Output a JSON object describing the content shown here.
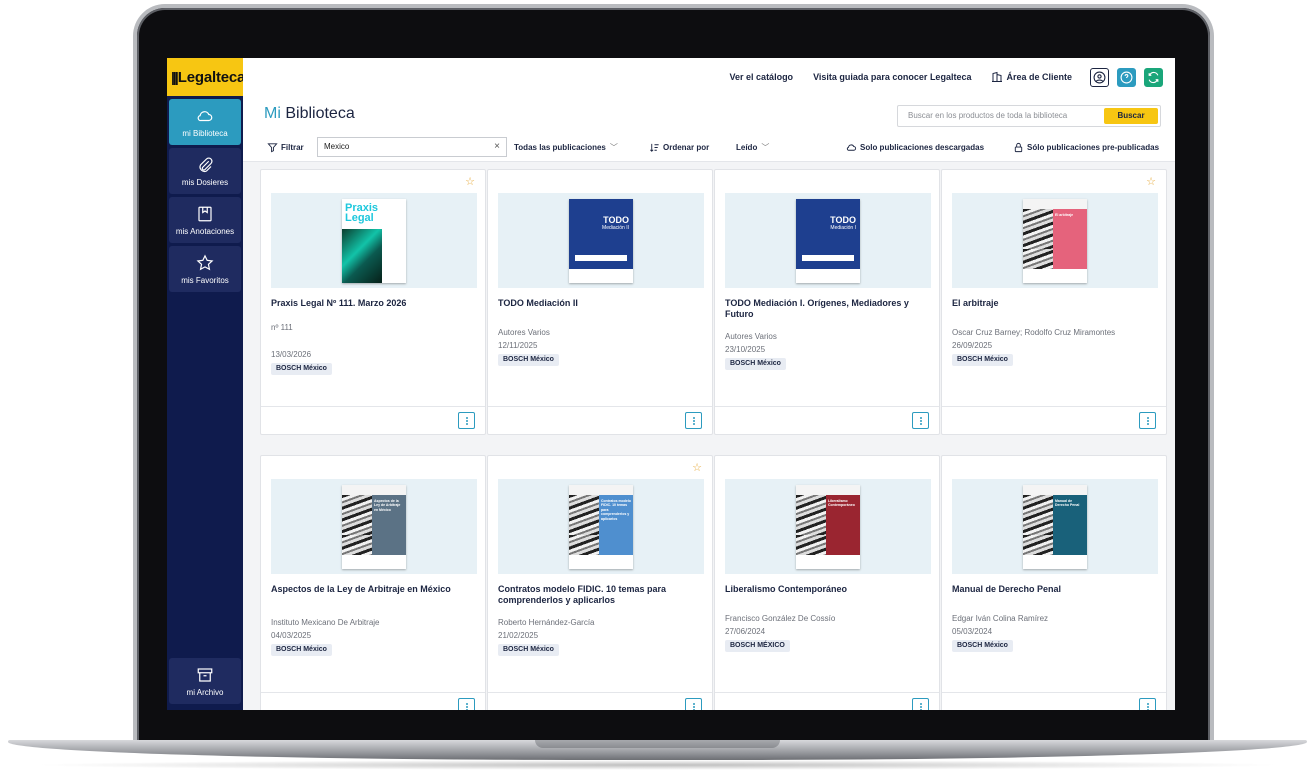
{
  "app": {
    "logo_text": "Legalteca",
    "page_title_prefix": "Mi",
    "page_title": "Biblioteca"
  },
  "sidebar": {
    "items": [
      {
        "label": "mi Biblioteca",
        "icon": "cloud-icon",
        "active": true
      },
      {
        "label": "mis Dosieres",
        "icon": "paperclip-icon"
      },
      {
        "label": "mis Anotaciones",
        "icon": "bookmark-icon"
      },
      {
        "label": "mis Favoritos",
        "icon": "star-icon"
      }
    ],
    "archive_label": "mi Archivo"
  },
  "header": {
    "catalog_link": "Ver el catálogo",
    "tour_link": "Visita guiada para conocer Legalteca",
    "client_area": "Área de Cliente",
    "icons": [
      "user-icon",
      "help-icon",
      "sync-icon"
    ]
  },
  "search": {
    "placeholder": "Buscar en los productos de toda la biblioteca",
    "button": "Buscar"
  },
  "filters": {
    "filter_label": "Filtrar",
    "filter_value": "Mexico",
    "publications": "Todas las publicaciones",
    "order_by": "Ordenar por",
    "read": "Leído",
    "downloaded": "Solo publicaciones descargadas",
    "prepublished": "Sólo publicaciones pre-publicadas"
  },
  "colors": {
    "sidebar": "#0f1b4d",
    "accent": "#2c9bbf",
    "brand_yellow": "#f7c612",
    "star": "#e6a93a"
  },
  "cards": [
    {
      "title": "Praxis Legal Nº 111. Marzo 2026",
      "author": "nº 111",
      "date": "13/03/2026",
      "publisher": "BOSCH México",
      "favorite": true,
      "cover": "praxis"
    },
    {
      "title": "TODO Mediación II",
      "author": "Autores Varios",
      "date": "12/11/2025",
      "publisher": "BOSCH México",
      "favorite": false,
      "cover": "todo2",
      "cover_title": "TODO",
      "cover_sub": "Mediación II"
    },
    {
      "title": "TODO Mediación I. Orígenes, Mediadores y Futuro",
      "author": "Autores Varios",
      "date": "23/10/2025",
      "publisher": "BOSCH México",
      "favorite": false,
      "cover": "todo1",
      "cover_title": "TODO",
      "cover_sub": "Mediación I"
    },
    {
      "title": "El arbitraje",
      "author": "Oscar Cruz Barney; Rodolfo Cruz Miramontes",
      "date": "26/09/2025",
      "publisher": "BOSCH México",
      "favorite": true,
      "cover": "pink",
      "cover_sub": "El arbitraje"
    },
    {
      "title": "Aspectos de la Ley de Arbitraje en México",
      "author": "Instituto Mexicano De Arbitraje",
      "date": "04/03/2025",
      "publisher": "BOSCH México",
      "favorite": false,
      "cover": "slate",
      "cover_sub": "Aspectos de la Ley de Arbitraje en México"
    },
    {
      "title": "Contratos modelo FIDIC. 10 temas para comprenderlos y aplicarlos",
      "author": "Roberto Hernández-García",
      "date": "21/02/2025",
      "publisher": "BOSCH México",
      "favorite": true,
      "cover": "lightblue",
      "cover_sub": "Contratos modelo FIDIC. 10 temas para comprenderlos y aplicarlos"
    },
    {
      "title": "Liberalismo Contemporáneo",
      "author": "Francisco González De Cossío",
      "date": "27/06/2024",
      "publisher": "BOSCH MÉXICO",
      "favorite": false,
      "cover": "maroon",
      "cover_sub": "Liberalismo Contemporáneo"
    },
    {
      "title": "Manual de Derecho Penal",
      "author": "Edgar Iván Colina Ramírez",
      "date": "05/03/2024",
      "publisher": "BOSCH México",
      "favorite": false,
      "cover": "teal",
      "cover_sub": "Manual de Derecho Penal"
    }
  ]
}
